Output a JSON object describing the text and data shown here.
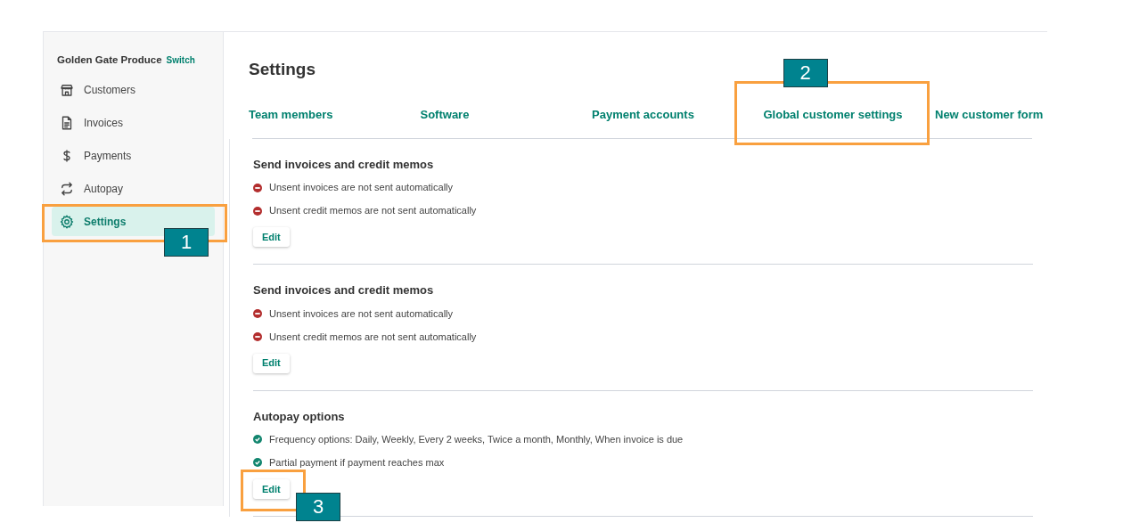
{
  "sidebar": {
    "account": "Golden Gate Produce",
    "switch_link": "Switch",
    "items": [
      {
        "label": "Customers",
        "selected": false
      },
      {
        "label": "Invoices",
        "selected": false
      },
      {
        "label": "Payments",
        "selected": false
      },
      {
        "label": "Autopay",
        "selected": false
      },
      {
        "label": "Settings",
        "selected": true,
        "callout": "1"
      }
    ]
  },
  "page_title": "Settings",
  "tabs": [
    {
      "label": "Team members"
    },
    {
      "label": "Software"
    },
    {
      "label": "Payment accounts"
    },
    {
      "label": "Global customer settings",
      "callout": "2"
    },
    {
      "label": "New customer form"
    }
  ],
  "sections": [
    {
      "title": "Send invoices and credit memos",
      "items": [
        {
          "kind": "off",
          "text": "Unsent invoices are not sent automatically"
        },
        {
          "kind": "off",
          "text": "Unsent credit memos are not sent automatically"
        }
      ],
      "button": "Edit"
    },
    {
      "title": "Send invoices and credit memos",
      "items": [
        {
          "kind": "off",
          "text": "Unsent invoices are not sent automatically"
        },
        {
          "kind": "off",
          "text": "Unsent credit memos are not sent automatically"
        }
      ],
      "button": "Edit"
    },
    {
      "title": "Autopay options",
      "items": [
        {
          "kind": "on",
          "text": "Frequency options: Daily, Weekly, Every 2 weeks, Twice a month, Monthly, When invoice is due"
        },
        {
          "kind": "on",
          "text": "Partial payment if payment reaches max"
        }
      ],
      "button": "Edit",
      "callout": "3"
    }
  ]
}
